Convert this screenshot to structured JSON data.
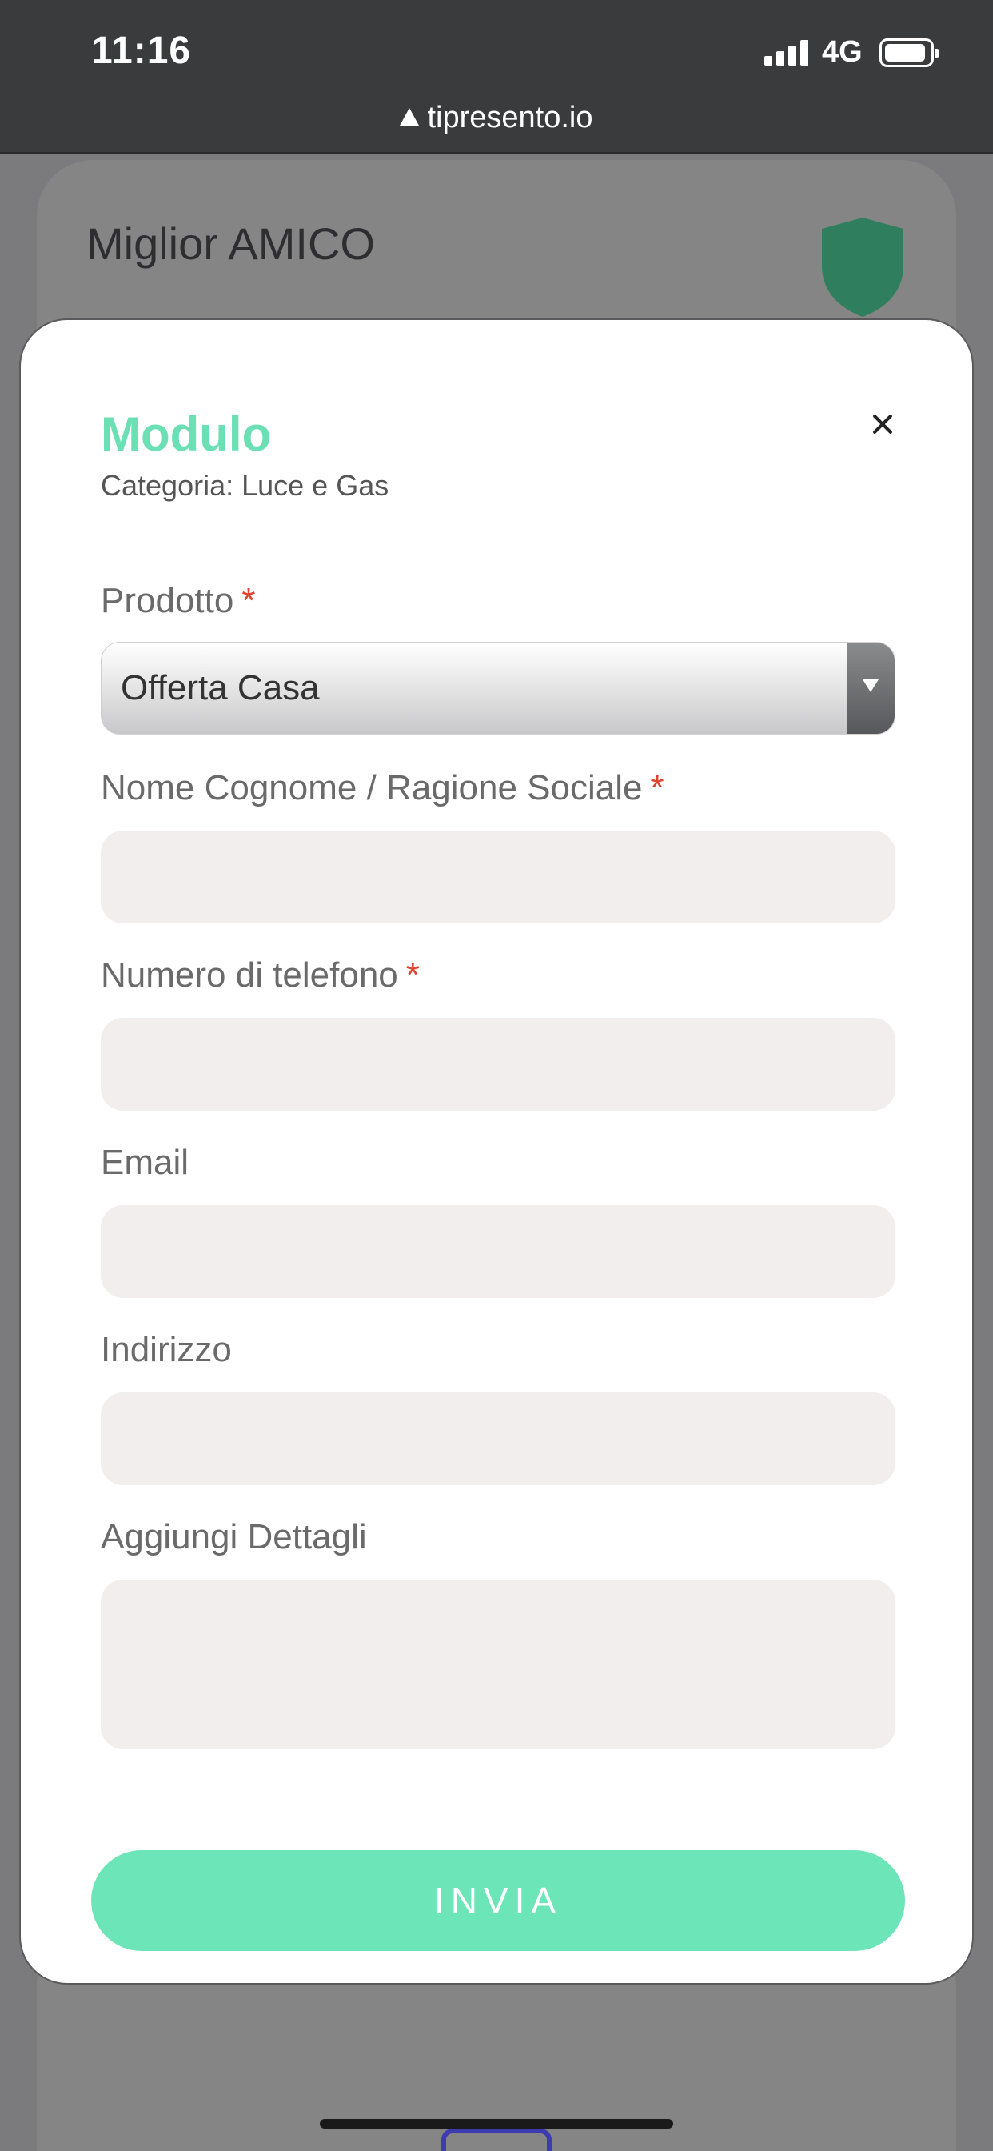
{
  "status_bar": {
    "time": "11:16",
    "network": "4G"
  },
  "browser": {
    "url": "tipresento.io"
  },
  "background_card": {
    "title": "Miglior AMICO",
    "shield_color": "#2f7f5f"
  },
  "modal": {
    "title": "Modulo",
    "subtitle": "Categoria: Luce e Gas",
    "accent_color": "#6ce0b5",
    "fields": {
      "prodotto": {
        "label": "Prodotto",
        "required_mark": "*",
        "value": "Offerta Casa"
      },
      "nome": {
        "label": "Nome Cognome / Ragione Sociale",
        "required_mark": "*",
        "value": ""
      },
      "telefono": {
        "label": "Numero di telefono",
        "required_mark": "*",
        "value": ""
      },
      "email": {
        "label": "Email",
        "value": ""
      },
      "indirizzo": {
        "label": "Indirizzo",
        "value": ""
      },
      "dettagli": {
        "label": "Aggiungi Dettagli",
        "value": ""
      }
    },
    "submit_label": "INVIA"
  }
}
